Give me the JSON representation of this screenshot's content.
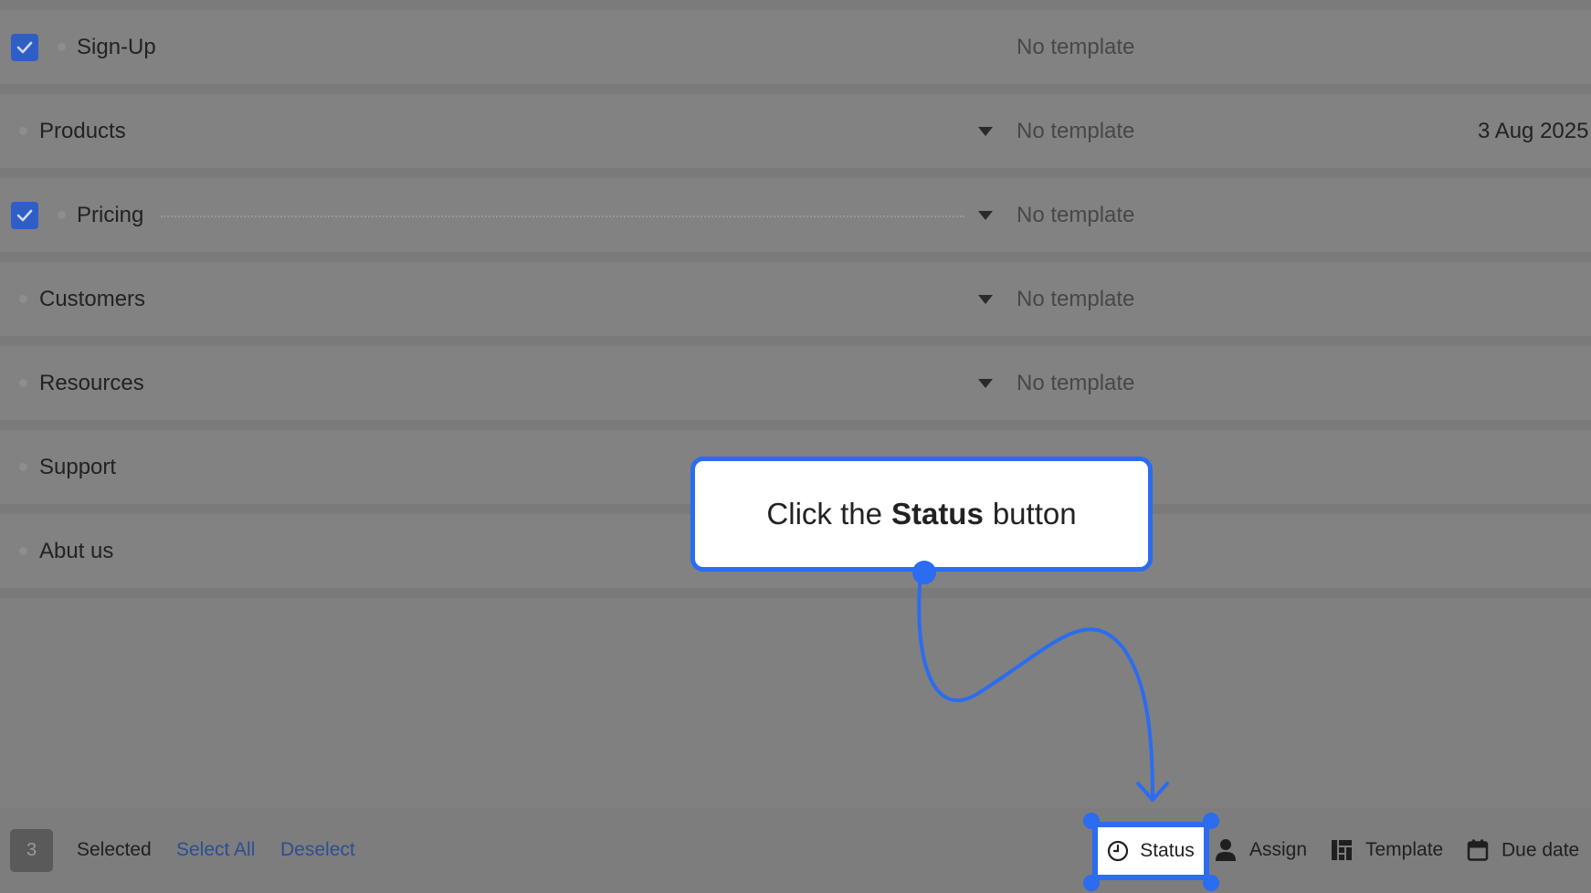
{
  "rows": [
    {
      "name": "Sign-Up",
      "template": "No template",
      "checked": true,
      "date": "",
      "has_caret": false,
      "has_dotted": false
    },
    {
      "name": "Products",
      "template": "No template",
      "checked": false,
      "date": "3 Aug 2025",
      "has_caret": true,
      "has_dotted": false
    },
    {
      "name": "Pricing",
      "template": "No template",
      "checked": true,
      "date": "",
      "has_caret": true,
      "has_dotted": true
    },
    {
      "name": "Customers",
      "template": "No template",
      "checked": false,
      "date": "",
      "has_caret": true,
      "has_dotted": false
    },
    {
      "name": "Resources",
      "template": "No template",
      "checked": false,
      "date": "",
      "has_caret": true,
      "has_dotted": false
    },
    {
      "name": "Support",
      "template": "",
      "checked": false,
      "date": "",
      "has_caret": false,
      "has_dotted": false
    },
    {
      "name": "Abut us",
      "template": "",
      "checked": false,
      "date": "",
      "has_caret": false,
      "has_dotted": false
    }
  ],
  "bottom_bar": {
    "selected_count": "3",
    "selected_label": "Selected",
    "select_all_label": "Select All",
    "deselect_label": "Deselect",
    "actions": {
      "status": {
        "label": "Status",
        "icon": "clock-icon"
      },
      "assign": {
        "label": "Assign",
        "icon": "person-icon"
      },
      "template": {
        "label": "Template",
        "icon": "template-icon"
      },
      "due_date": {
        "label": "Due date",
        "icon": "calendar-icon"
      }
    }
  },
  "tooltip": {
    "prefix": "Click the",
    "emphasis": "Status",
    "suffix": "button"
  },
  "colors": {
    "accent": "#2b6cf0",
    "overlay": "#808080",
    "checkbox": "#2f5fc6",
    "link": "#2c4e92"
  }
}
